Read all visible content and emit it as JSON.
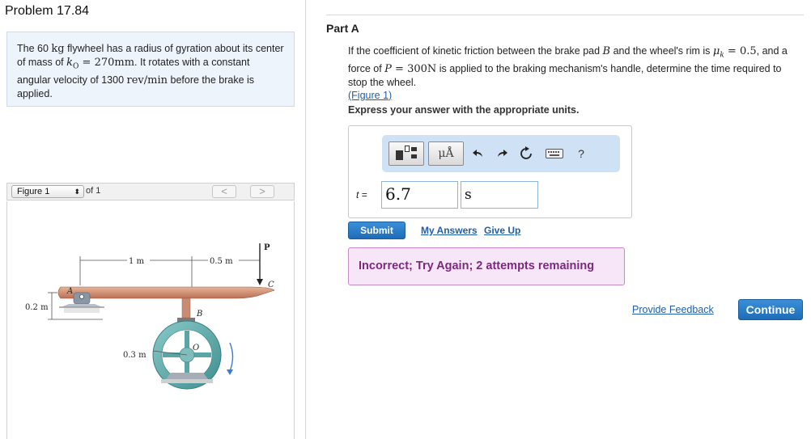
{
  "problem": {
    "title": "Problem 17.84",
    "text": {
      "p1": "The 60 ",
      "m1": "kg",
      "p2": " flywheel has a radius of gyration about its center of mass of ",
      "m2": "k",
      "m2sub": "O",
      "m3": " = 270mm",
      "p3": ". It rotates with a constant angular velocity of 1300 ",
      "m4": "rev/min",
      "p4": " before the brake is applied."
    }
  },
  "figure": {
    "selector_label": "Figure 1",
    "of_label": "of 1",
    "prev_label": "<",
    "next_label": ">",
    "labels": {
      "dim_1m": "1 m",
      "dim_05m": "0.5 m",
      "P": "P",
      "C": "C",
      "A": "A",
      "B": "B",
      "O": "O",
      "dim_02m": "0.2 m",
      "dim_03m": "0.3 m"
    }
  },
  "part": {
    "title": "Part A",
    "q1": "If the coefficient of kinetic friction between the brake pad ",
    "qB": "B",
    "q2": " and the wheel's rim is ",
    "qmu": "μ",
    "qmusub": "k",
    "qmuval": " = 0.5",
    "q3": ", and a force of ",
    "qP": "P",
    "qPval": " = 300N",
    "q4": " is applied to the braking mechanism's handle, determine the time required to stop the wheel.",
    "figure_link": "(Figure 1)",
    "express": "Express your answer with the appropriate units."
  },
  "toolbar": {
    "mu_label": "μÅ",
    "help_label": "?",
    "icons": [
      "templates-icon",
      "units-icon",
      "undo-icon",
      "redo-icon",
      "reset-icon",
      "keyboard-icon",
      "help-icon"
    ]
  },
  "answer": {
    "variable": "t =",
    "value": "6.7",
    "unit": "s"
  },
  "actions": {
    "submit": "Submit",
    "my_answers": "My Answers",
    "give_up": "Give Up"
  },
  "feedback": {
    "text": "Incorrect; Try Again; 2 attempts remaining",
    "color": "#7b2a7b",
    "background": "#f7e6f7"
  },
  "footer": {
    "provide_feedback": "Provide Feedback",
    "continue": "Continue"
  },
  "colors": {
    "accent": "#1e6cb7",
    "link": "#1f5fa8",
    "toolbar_bg": "#cfe2f5",
    "problem_bg": "#eef4fb"
  }
}
